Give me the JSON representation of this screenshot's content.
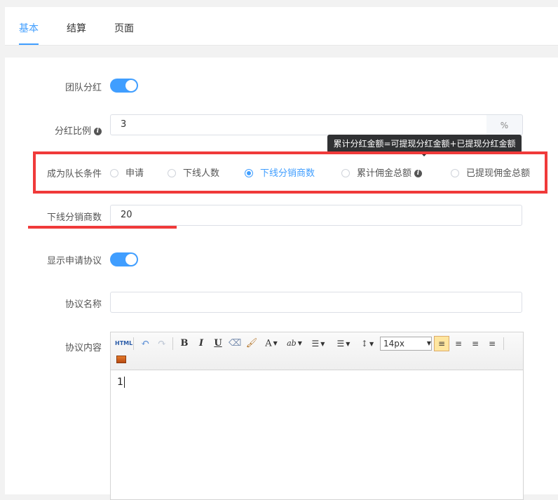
{
  "tabs": [
    {
      "label": "基本",
      "active": true
    },
    {
      "label": "结算",
      "active": false
    },
    {
      "label": "页面",
      "active": false
    }
  ],
  "colors": {
    "accent": "#409eff",
    "annotation_red": "#f03a3a",
    "tooltip_bg": "#303133"
  },
  "form": {
    "team_dividend": {
      "label": "团队分红",
      "enabled": true
    },
    "dividend_ratio": {
      "label": "分红比例",
      "value": "3",
      "suffix": "%",
      "icon": "info-icon"
    },
    "leader_condition": {
      "label": "成为队长条件",
      "options": [
        {
          "label": "申请",
          "checked": false
        },
        {
          "label": "下线人数",
          "checked": false
        },
        {
          "label": "下线分销商数",
          "checked": true
        },
        {
          "label": "累计佣金总额",
          "checked": false,
          "icon": "info-icon"
        },
        {
          "label": "已提现佣金总额",
          "checked": false
        }
      ],
      "tooltip": "累计分红金额=可提现分红金额+已提现分红金额"
    },
    "downline_distributors": {
      "label": "下线分销商数",
      "value": "20"
    },
    "show_agreement": {
      "label": "显示申请协议",
      "enabled": true
    },
    "agreement_name": {
      "label": "协议名称",
      "value": ""
    },
    "agreement_content": {
      "label": "协议内容",
      "editor": {
        "html_button": "HTML",
        "font_size": "14px",
        "content": "1"
      }
    }
  }
}
